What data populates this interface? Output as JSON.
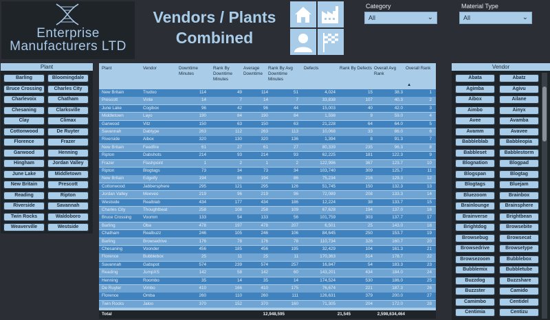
{
  "logo": {
    "line1": "Enterprise",
    "line2": "Manufacturers LTD"
  },
  "title": {
    "line1": "Vendors / Plants",
    "line2": "Combined"
  },
  "nav": {
    "home_icon": "home-icon",
    "factory_icon": "factory-icon",
    "user_icon": "user-icon",
    "finish_icon": "checkered-flag-icon"
  },
  "filters": {
    "category": {
      "label": "Category",
      "value": "All"
    },
    "material_type": {
      "label": "Material Type",
      "value": "All"
    }
  },
  "plant_slicer": {
    "title": "Plant",
    "items": [
      "Barling",
      "Bloomingdale",
      "Bruce Crossing",
      "Charles City",
      "Charlevoix",
      "Chatham",
      "Chesaning",
      "Clarksville",
      "Clay",
      "Climax",
      "Cottonwood",
      "De Ruyter",
      "Florence",
      "Frazer",
      "Garwood",
      "Henning",
      "Hingham",
      "Jordan Valley",
      "June Lake",
      "Middletown",
      "New Britain",
      "Prescott",
      "Reading",
      "Ripton",
      "Riverside",
      "Savannah",
      "Twin Rocks",
      "Waldoboro",
      "Weaverville",
      "Westside"
    ]
  },
  "table": {
    "columns": [
      "Plant",
      "Vendor",
      "Downtime Minutes",
      "Rank By Downtime Minutes",
      "Average Downtime",
      "Rank By Avg Downtime Minutes",
      "Defects",
      "Rank By Defects",
      "Overall Avg Rank",
      "Overall Rank"
    ],
    "sort_indicator": "▲",
    "rows": [
      [
        "New Britain",
        "Trudoo",
        "114",
        "49",
        "114",
        "51",
        "4,024",
        "15",
        "38.3",
        "1"
      ],
      [
        "Prescott",
        "Vinte",
        "14",
        "7",
        "14",
        "7",
        "33,838",
        "107",
        "40.3",
        "2"
      ],
      [
        "June Lake",
        "Cogibox",
        "96",
        "42",
        "96",
        "44",
        "15,003",
        "40",
        "42.0",
        "3"
      ],
      [
        "Middletown",
        "Layo",
        "190",
        "84",
        "190",
        "84",
        "1,598",
        "9",
        "59.0",
        "4"
      ],
      [
        "Garwood",
        "Vitz",
        "150",
        "63",
        "150",
        "63",
        "21,228",
        "64",
        "64.0",
        "5"
      ],
      [
        "Savannah",
        "Dabtype",
        "263",
        "112",
        "263",
        "113",
        "10,068",
        "33",
        "86.0",
        "6"
      ],
      [
        "Riverside",
        "Aibox",
        "320",
        "130",
        "320",
        "136",
        "1,394",
        "8",
        "91.3",
        "7"
      ],
      [
        "New Britain",
        "Feedfire",
        "61",
        "27",
        "61",
        "27",
        "80,339",
        "235",
        "96.3",
        "8"
      ],
      [
        "Ripton",
        "Dabshots",
        "214",
        "93",
        "214",
        "93",
        "62,225",
        "181",
        "122.3",
        "9"
      ],
      [
        "Frazer",
        "Flashpoint",
        "1",
        "2",
        "1",
        "2",
        "122,996",
        "367",
        "123.7",
        "10"
      ],
      [
        "Ripton",
        "Blogtags",
        "73",
        "34",
        "73",
        "34",
        "103,740",
        "309",
        "125.7",
        "11"
      ],
      [
        "New Britain",
        "Edgeify",
        "194",
        "86",
        "194",
        "86",
        "75,234",
        "216",
        "129.3",
        "12"
      ],
      [
        "Cottonwood",
        "Jabbersphere",
        "295",
        "121",
        "295",
        "126",
        "51,745",
        "150",
        "132.3",
        "13"
      ],
      [
        "Jordan Valley",
        "Meeveo",
        "219",
        "96",
        "219",
        "96",
        "72,089",
        "208",
        "133.3",
        "14"
      ],
      [
        "Westside",
        "Realblab",
        "434",
        "177",
        "434",
        "186",
        "12,224",
        "38",
        "133.7",
        "15"
      ],
      [
        "Charles City",
        "Thoughtbeat",
        "258",
        "108",
        "258",
        "109",
        "67,628",
        "194",
        "137.0",
        "16"
      ],
      [
        "Bruce Crossing",
        "Voomm",
        "133",
        "54",
        "133",
        "56",
        "101,759",
        "303",
        "137.7",
        "17"
      ],
      [
        "Barling",
        "Oba",
        "478",
        "197",
        "478",
        "207",
        "6,501",
        "25",
        "143.0",
        "18"
      ],
      [
        "Chatham",
        "Realbuzz",
        "246",
        "105",
        "246",
        "106",
        "84,645",
        "250",
        "153.7",
        "19"
      ],
      [
        "Barling",
        "Browsedrive",
        "176",
        "78",
        "176",
        "78",
        "110,734",
        "326",
        "160.7",
        "20"
      ],
      [
        "Chesaning",
        "Voonder",
        "456",
        "185",
        "456",
        "195",
        "32,429",
        "104",
        "161.3",
        "21"
      ],
      [
        "Florence",
        "Bubblebox",
        "25",
        "11",
        "25",
        "11",
        "170,363",
        "514",
        "178.7",
        "22"
      ],
      [
        "Savannah",
        "Gabspot",
        "574",
        "239",
        "574",
        "257",
        "16,847",
        "54",
        "183.3",
        "23"
      ],
      [
        "Reading",
        "JumpXS",
        "142",
        "58",
        "142",
        "60",
        "143,201",
        "434",
        "184.0",
        "24"
      ],
      [
        "Henning",
        "Roombo",
        "35",
        "14",
        "35",
        "14",
        "174,524",
        "530",
        "186.0",
        "25"
      ],
      [
        "De Ruyter",
        "Vimbo",
        "410",
        "166",
        "410",
        "175",
        "76,674",
        "221",
        "187.3",
        "26"
      ],
      [
        "Florence",
        "Omba",
        "260",
        "110",
        "260",
        "111",
        "126,631",
        "379",
        "200.0",
        "27"
      ],
      [
        "Twin Rocks",
        "Jaloo",
        "370",
        "152",
        "370",
        "160",
        "71,305",
        "204",
        "172.0",
        "28"
      ]
    ],
    "total": {
      "label": "Total",
      "downtime": "12,948,595",
      "avg_downtime": "21,545",
      "defects": "2,598,634,464"
    }
  },
  "vendor_slicer": {
    "title": "Vendor",
    "items": [
      "Abata",
      "Abatz",
      "Agimba",
      "Agivu",
      "Aibox",
      "Ailane",
      "Aimbo",
      "Ainyx",
      "Avee",
      "Avamba",
      "Avamm",
      "Avavee",
      "Babbleblab",
      "Babbleopia",
      "Babbleset",
      "Babblestorm",
      "Blognation",
      "Blogpad",
      "Blogspan",
      "Blogtag",
      "Blogtags",
      "Bluejam",
      "Bluezoom",
      "Brainbox",
      "Brainlounge",
      "Brainsphere",
      "Brainverse",
      "Brightbean",
      "Brightdog",
      "Browsebite",
      "Browsebug",
      "Browsecat",
      "Browsedrive",
      "Browsetype",
      "Browsezoom",
      "Bubblebox",
      "Bubblemix",
      "Bubbletube",
      "Buzzdog",
      "Buzzshare",
      "Buzzster",
      "Camido",
      "Camimbo",
      "Centidel",
      "Centimia",
      "Centizu"
    ]
  }
}
